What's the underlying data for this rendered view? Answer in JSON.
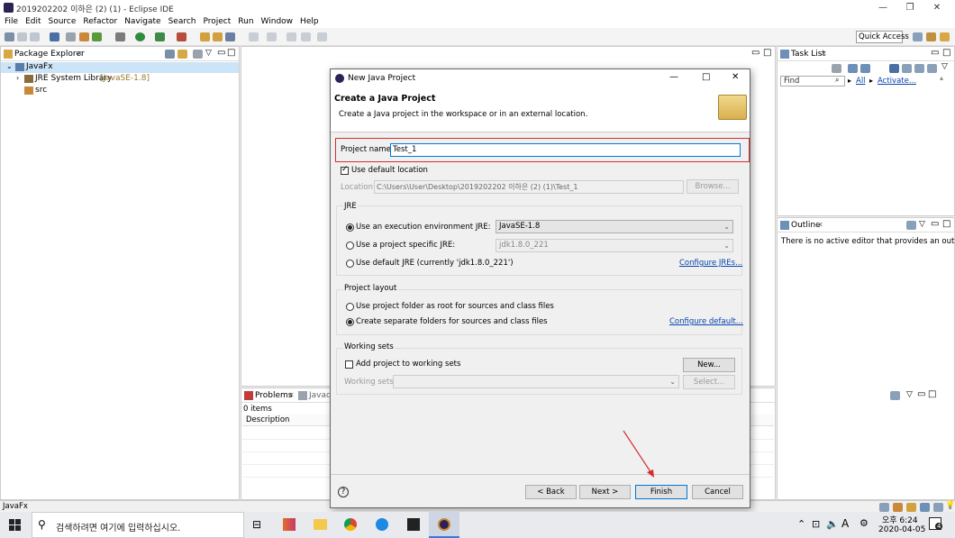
{
  "window": {
    "title": "2019202202 이하은 (2) (1) - Eclipse IDE",
    "controls": [
      "—",
      "❐",
      "✕"
    ]
  },
  "menu": [
    "File",
    "Edit",
    "Source",
    "Refactor",
    "Navigate",
    "Search",
    "Project",
    "Run",
    "Window",
    "Help"
  ],
  "toolbar": {
    "quick_access": "Quick Access"
  },
  "package_explorer": {
    "tab": "Package Explorer",
    "tree": {
      "project": "JavaFx",
      "library": "JRE System Library",
      "library_version": "[JavaSE-1.8]",
      "src": "src"
    }
  },
  "task_list": {
    "tab": "Task List",
    "find_placeholder": "Find",
    "all": "All",
    "activate": "Activate..."
  },
  "outline": {
    "tab": "Outline",
    "message": "There is no active editor that provides an outline."
  },
  "problems": {
    "tab": "Problems",
    "tab2": "Javadc",
    "count": "0 items",
    "column": "Description"
  },
  "status_bar": {
    "selection": "JavaFx"
  },
  "dialog": {
    "title": "New Java Project",
    "header": "Create a Java Project",
    "subheader": "Create a Java project in the workspace or in an external location.",
    "project_name_label": "Project name:",
    "project_name_value": "Test_1",
    "use_default_location": "Use default location",
    "location_label": "Location:",
    "location_value": "C:\\Users\\User\\Desktop\\2019202202 이하은 (2) (1)\\Test_1",
    "browse": "Browse...",
    "jre_group": "JRE",
    "jre_opt1": "Use an execution environment JRE:",
    "jre_opt1_value": "JavaSE-1.8",
    "jre_opt2": "Use a project specific JRE:",
    "jre_opt2_value": "jdk1.8.0_221",
    "jre_opt3": "Use default JRE (currently 'jdk1.8.0_221')",
    "configure_jres": "Configure JREs...",
    "layout_group": "Project layout",
    "layout_opt1": "Use project folder as root for sources and class files",
    "layout_opt2": "Create separate folders for sources and class files",
    "configure_default": "Configure default...",
    "ws_group": "Working sets",
    "ws_add": "Add project to working sets",
    "ws_new": "New...",
    "ws_label": "Working sets:",
    "ws_select": "Select...",
    "back": "< Back",
    "next": "Next >",
    "finish": "Finish",
    "cancel": "Cancel",
    "help": "?"
  },
  "taskbar": {
    "search_placeholder": "검색하려면 여기에 입력하십시오.",
    "time": "오후 6:24",
    "date": "2020-04-05",
    "notification_count": "4",
    "lang": "A"
  },
  "colors": {
    "highlight_red": "#d32f2f",
    "link_blue": "#0645ad",
    "focus_blue": "#0078d7"
  }
}
